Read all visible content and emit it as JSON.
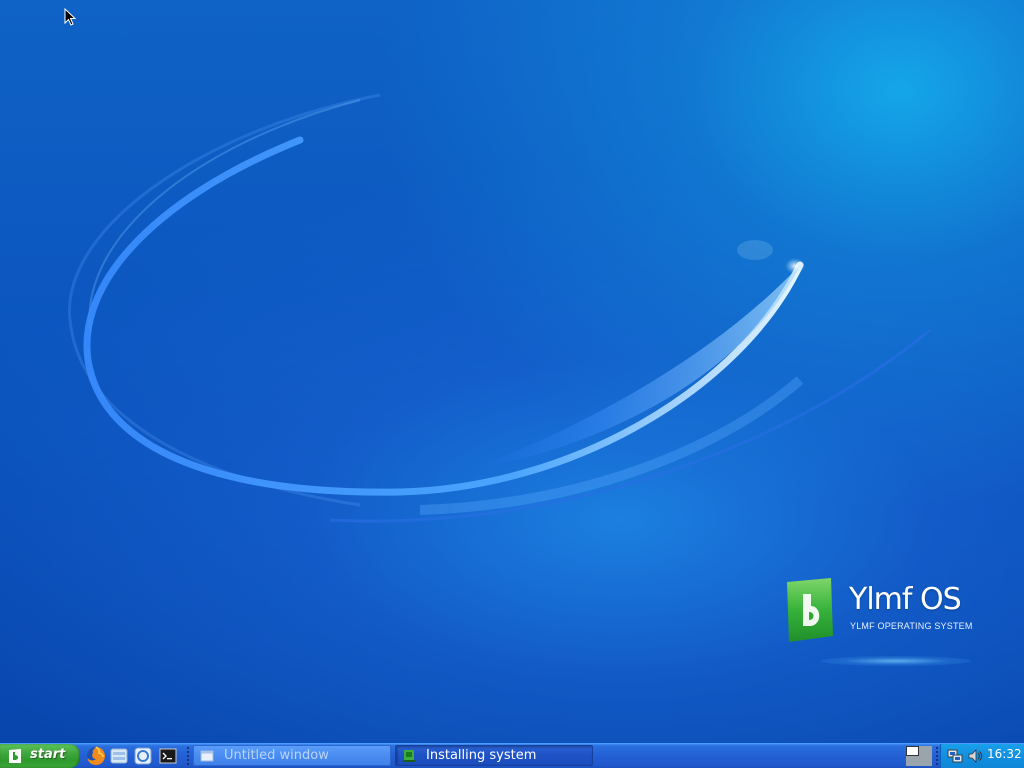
{
  "desktop": {
    "logo": {
      "title": "Ylmf OS",
      "subtitle": "YLMF OPERATING SYSTEM",
      "colors": {
        "badge": "#2eae3a",
        "text": "#ffffff"
      }
    }
  },
  "taskbar": {
    "start": {
      "label": "start",
      "icon": "ylmf-logo-icon",
      "color": "#3ea63c"
    },
    "quicklaunch": [
      {
        "name": "firefox",
        "icon": "firefox-icon"
      },
      {
        "name": "file-manager",
        "icon": "file-manager-icon"
      },
      {
        "name": "browser",
        "icon": "browser-icon"
      },
      {
        "name": "terminal",
        "icon": "terminal-icon"
      }
    ],
    "tasks": [
      {
        "label": "Untitled window",
        "icon": "window-icon",
        "active": false
      },
      {
        "label": "Installing system",
        "icon": "installer-icon",
        "active": true
      }
    ],
    "tray": {
      "icons": [
        "network-icon",
        "volume-icon"
      ],
      "clock": "16:32"
    },
    "colors": {
      "bar": "#2360d4",
      "tray": "#138fe0"
    }
  }
}
